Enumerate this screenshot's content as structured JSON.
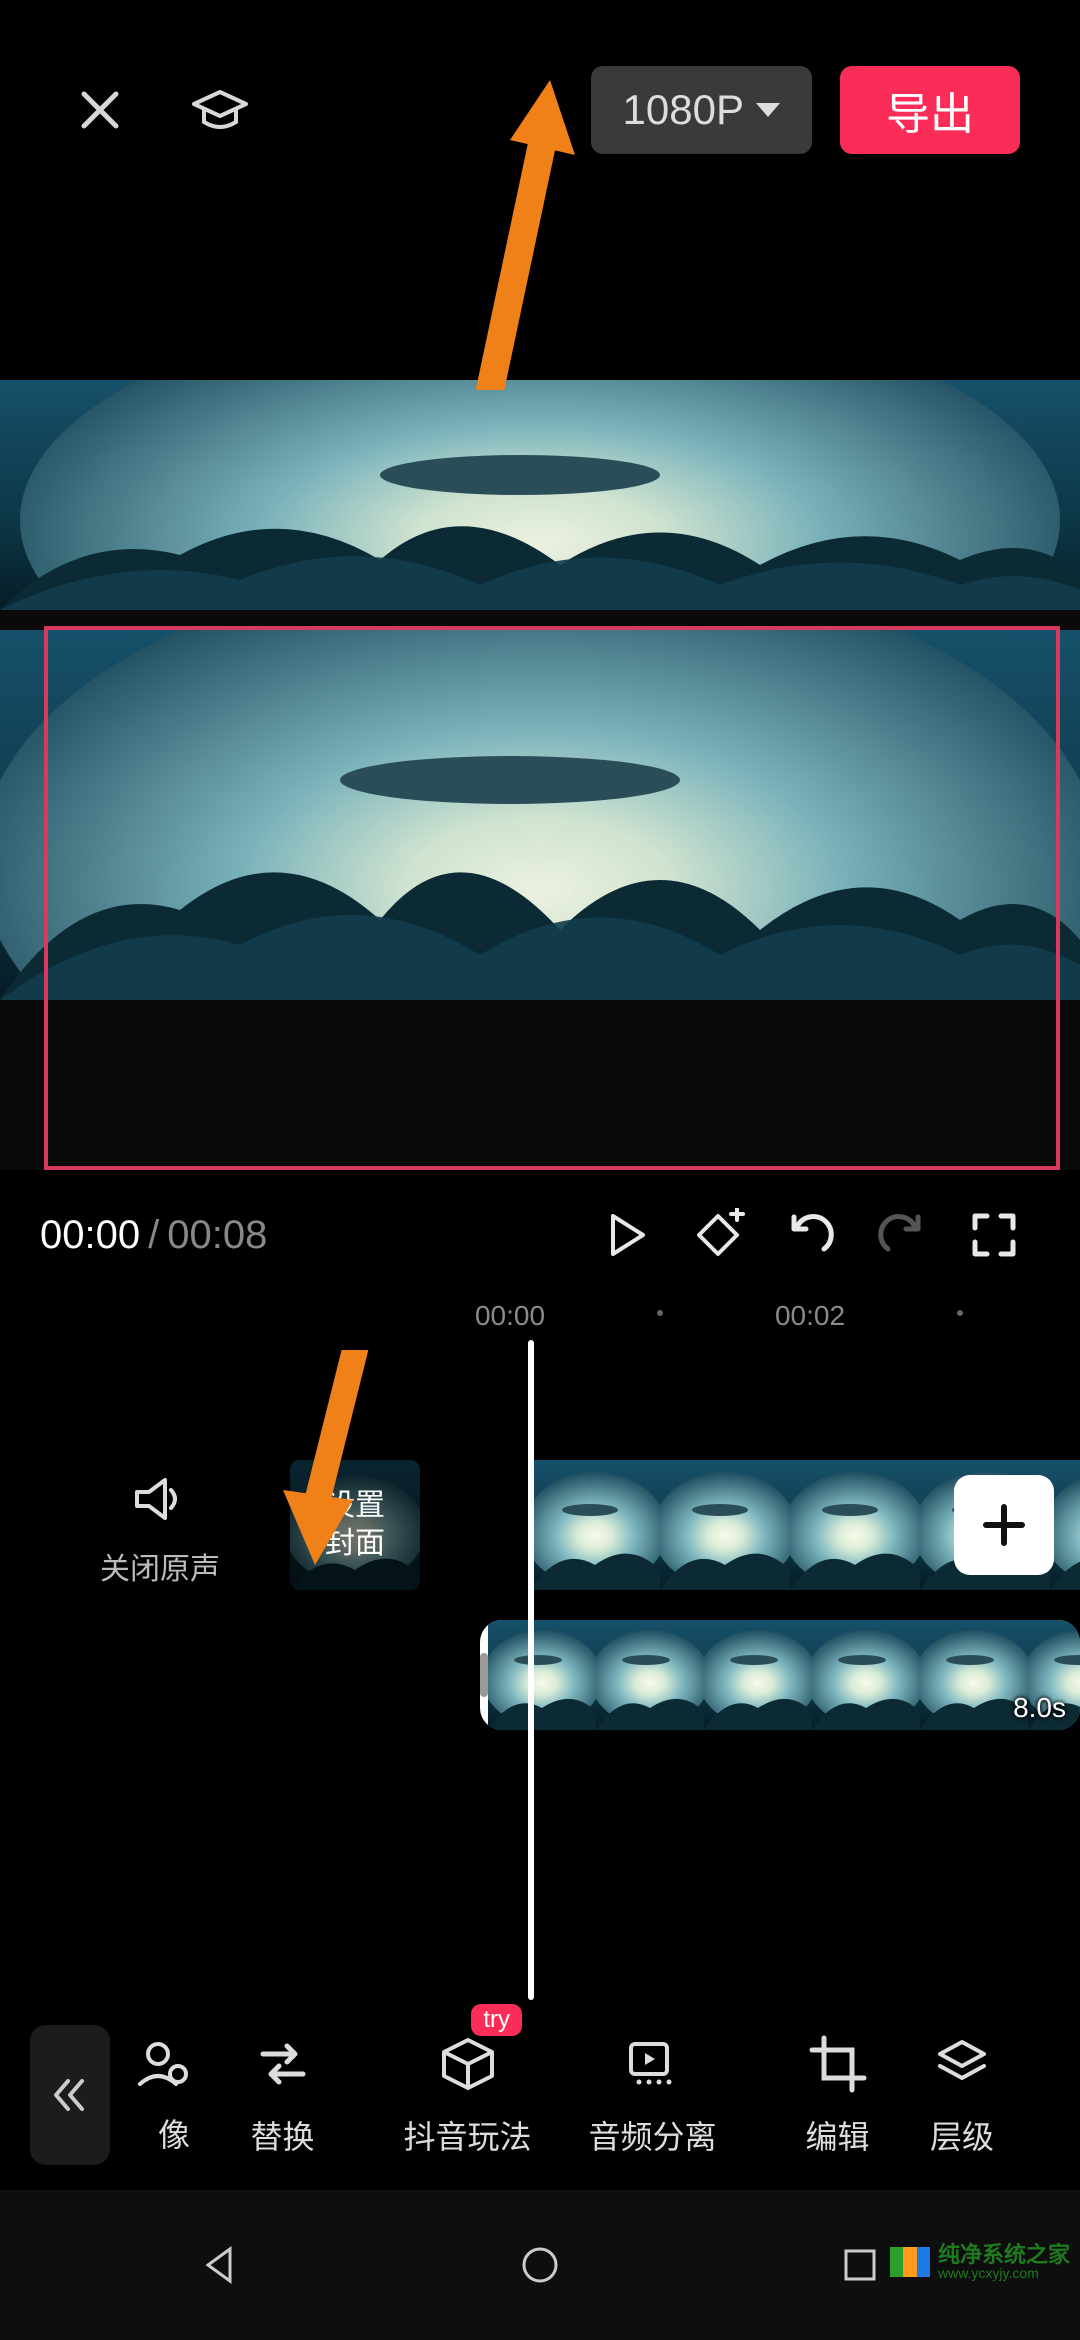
{
  "header": {
    "resolution_label": "1080P",
    "export_label": "导出"
  },
  "transport": {
    "current_time": "00:00",
    "separator": "/",
    "total_time": "00:08"
  },
  "ruler": {
    "t0": "00:00",
    "t1": "00:02"
  },
  "mute": {
    "label": "关闭原声"
  },
  "cover": {
    "line1": "设置",
    "line2": "封面"
  },
  "track_b": {
    "duration": "8.0s"
  },
  "tools": {
    "badge": "try",
    "item0_label": "像",
    "item1_label": "替换",
    "item2_label": "抖音玩法",
    "item3_label": "音频分离",
    "item4_label": "编辑",
    "item5_label": "层级"
  },
  "watermark": {
    "title": "纯净系统之家",
    "url": "www.ycxyjy.com"
  },
  "colors": {
    "accent": "#fa2d58",
    "selection": "#d73a5c",
    "annotation": "#f08018"
  }
}
